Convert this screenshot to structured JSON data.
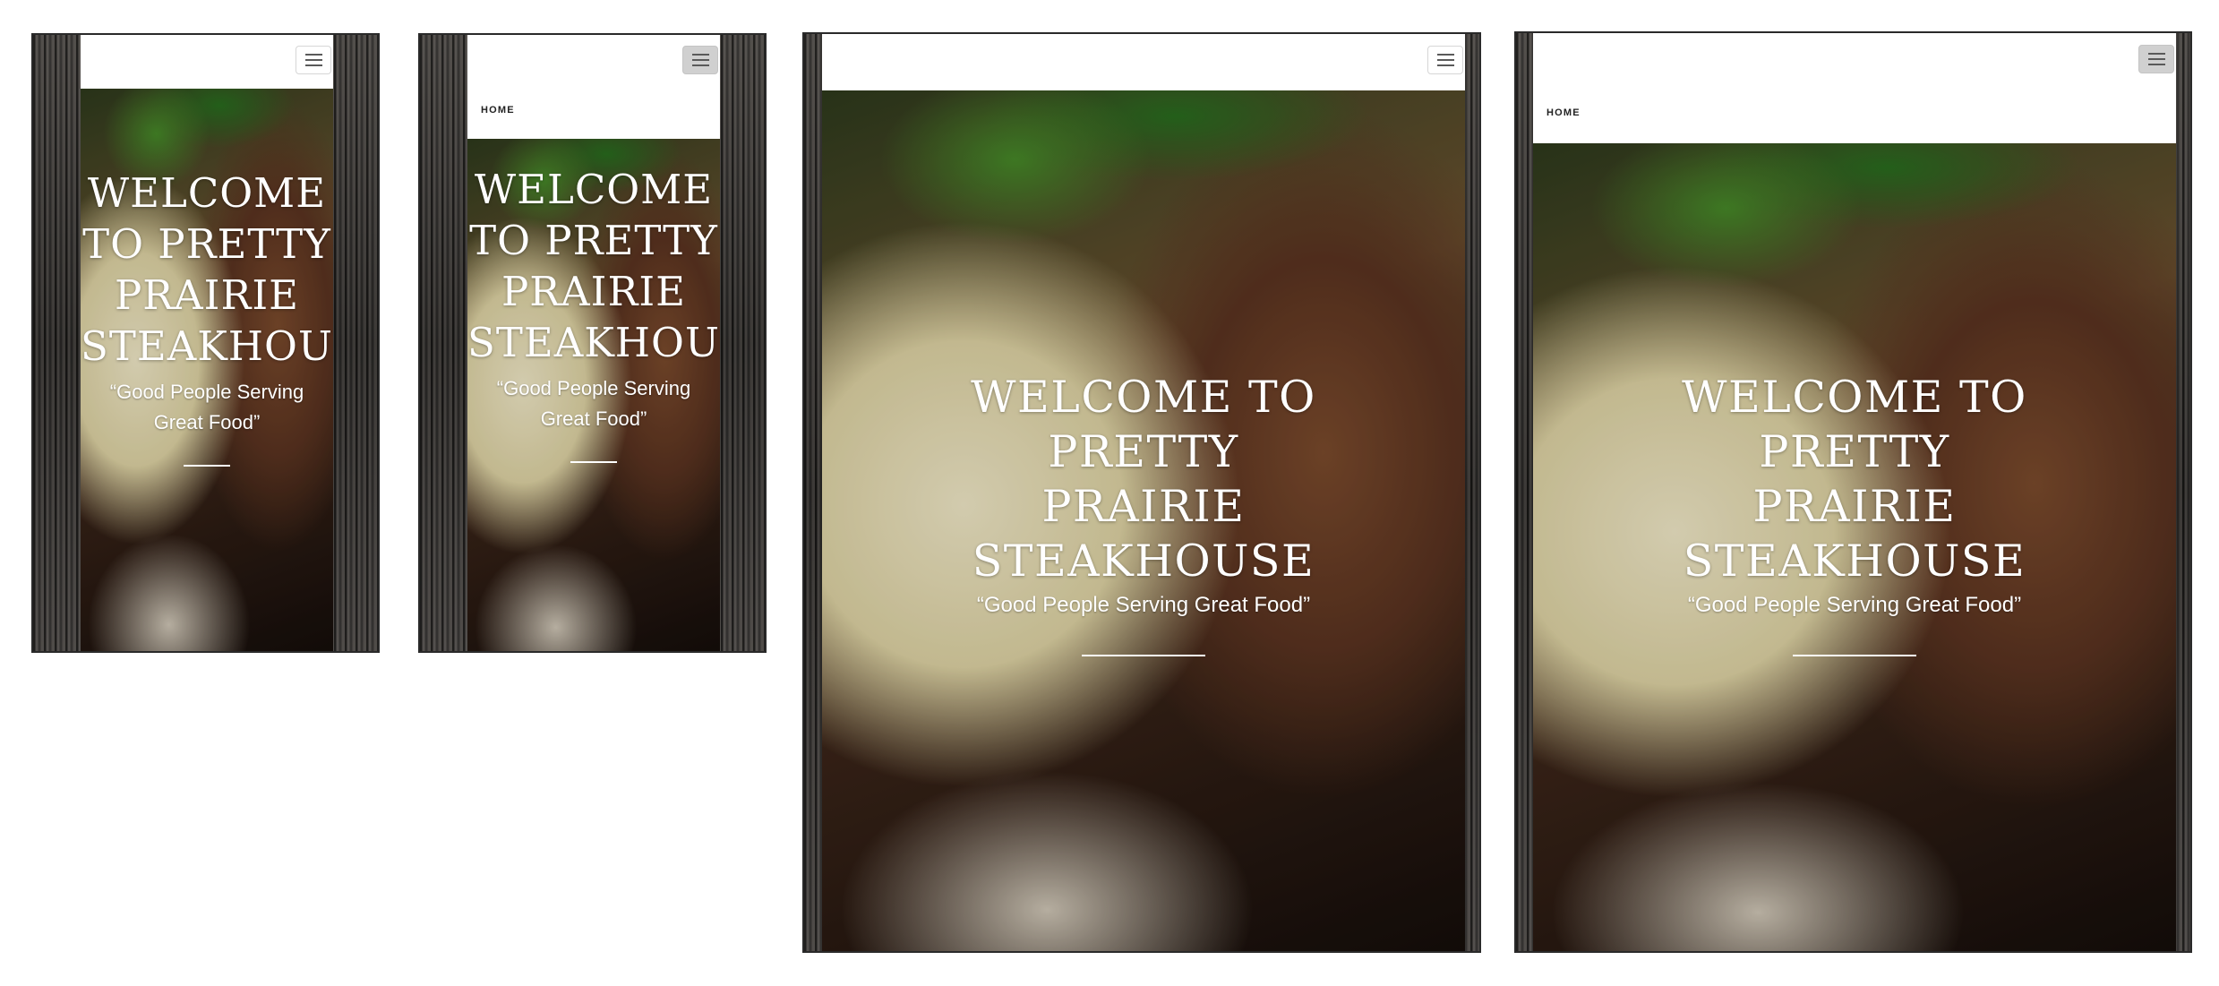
{
  "hero": {
    "title": "WELCOME TO PRETTY PRAIRIE STEAKHOUSE",
    "tagline": "“Good People Serving Great Food”"
  },
  "nav": {
    "home_label": "HOME"
  },
  "menu_icon": "hamburger-menu-icon",
  "colors": {
    "nav_background": "#ffffff",
    "hero_text": "#ffffff",
    "frame": "#3b3936",
    "menu_active": "#d0d0d0"
  },
  "devices": [
    {
      "name": "phone-collapsed",
      "menu_open": false
    },
    {
      "name": "phone-expanded",
      "menu_open": true
    },
    {
      "name": "tablet-collapsed",
      "menu_open": false
    },
    {
      "name": "tablet-expanded",
      "menu_open": true
    }
  ]
}
